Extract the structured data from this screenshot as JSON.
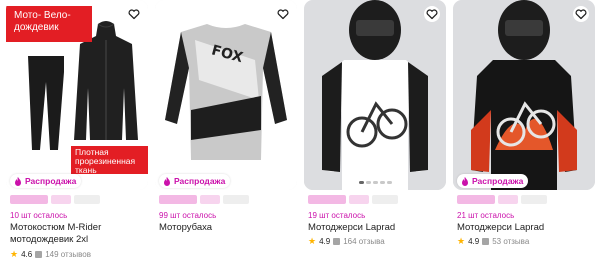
{
  "products": [
    {
      "ribbon": "Мото- Вело-\nдождевик",
      "note": "Плотная прорезиненная ткань",
      "sale": "Распродажа",
      "left": "10 шт осталось",
      "title": "Мотокостюм M-Rider мотодождевик 2xl",
      "rating": "4.6",
      "reviews": "149 отзывов"
    },
    {
      "sale": "Распродажа",
      "left": "99 шт осталось",
      "title": "Моторубаха"
    },
    {
      "sale": "Распродажа",
      "left": "19 шт осталось",
      "title": "Мотоджерси Laprad",
      "rating": "4.9",
      "reviews": "164 отзыва"
    },
    {
      "sale": "Распродажа",
      "left": "21 шт осталось",
      "title": "Мотоджерси Laprad",
      "rating": "4.9",
      "reviews": "53 отзыва"
    }
  ],
  "icons": {
    "favorite": "heart-icon",
    "sale": "fire-icon",
    "rating": "star-icon",
    "reviews": "comment-icon"
  },
  "colors": {
    "accent": "#cb11ab",
    "ribbon": "#e31e24",
    "star": "#ffb400"
  }
}
